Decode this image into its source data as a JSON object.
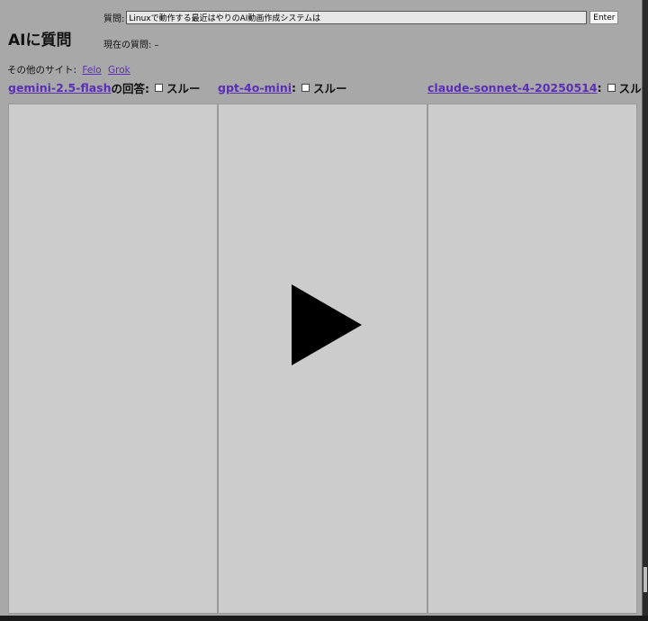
{
  "header": {
    "app_title": "AIに質問",
    "question_label": "質問:",
    "question_value": "Linuxで動作する最近はやりのAI動画作成システムは",
    "enter_label": "Enter",
    "current_question": "現在の質問: –"
  },
  "other_sites": {
    "label": "その他のサイト:",
    "links": [
      "Felo",
      "Grok"
    ]
  },
  "columns": [
    {
      "model": "gemini-2.5-flash",
      "suffix": "の回答:",
      "skip_label": "スルー"
    },
    {
      "model": "gpt-4o-mini",
      "suffix": ":",
      "skip_label": "スルー"
    },
    {
      "model": "claude-sonnet-4-20250514",
      "suffix": ":",
      "skip_label": "スルー"
    }
  ],
  "overlay": {
    "icon": "play-icon"
  }
}
